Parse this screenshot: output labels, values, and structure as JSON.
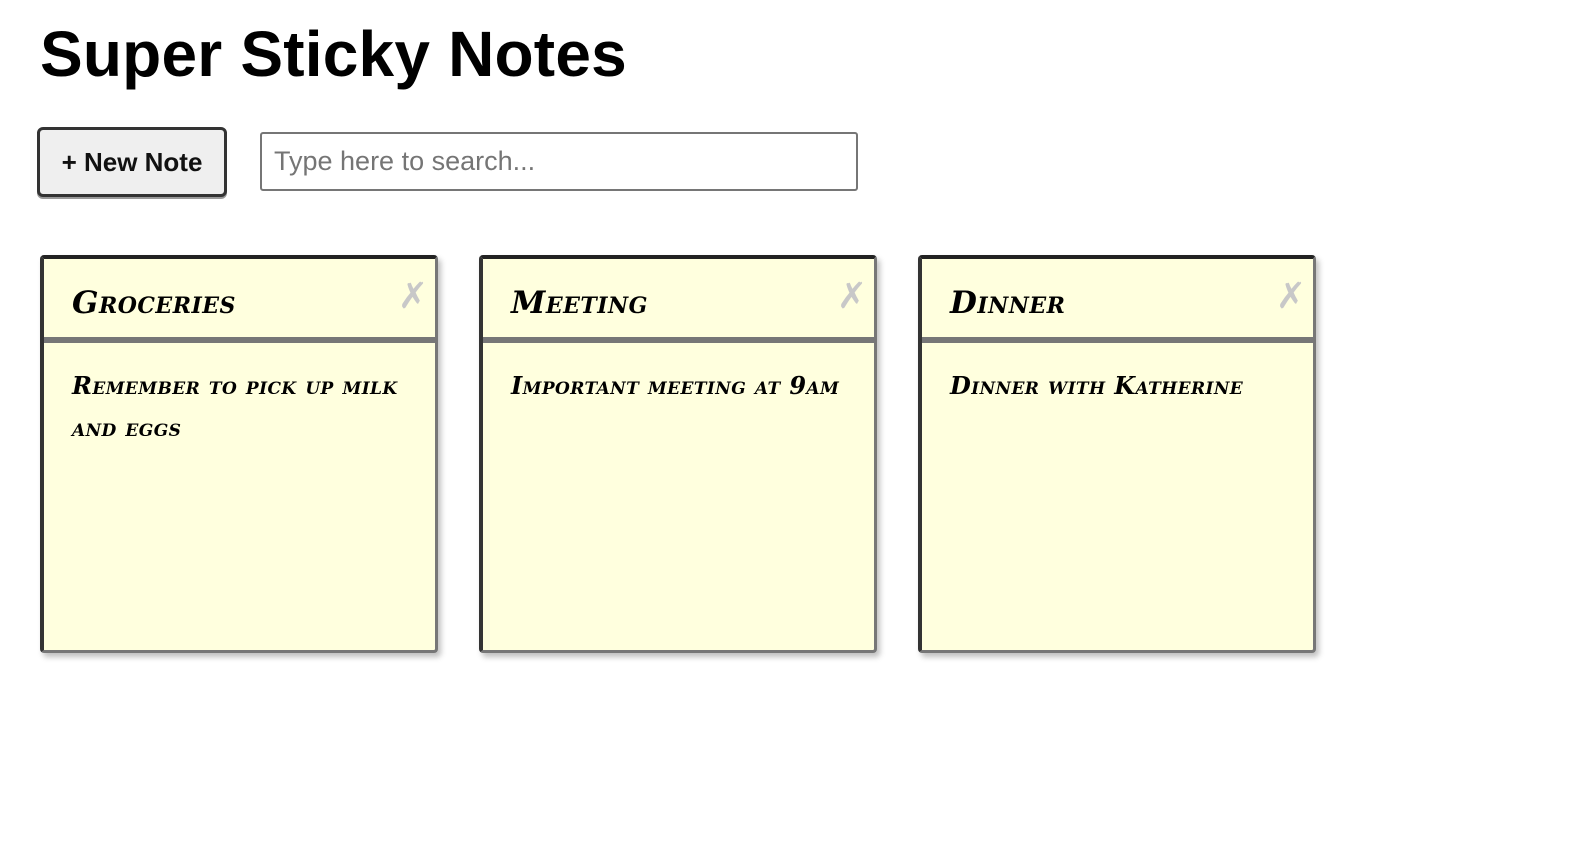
{
  "app": {
    "title": "Super Sticky Notes"
  },
  "toolbar": {
    "new_note_label": "+ New Note",
    "search": {
      "placeholder": "Type here to search...",
      "value": ""
    }
  },
  "notes": [
    {
      "title": "Groceries",
      "body": "Remember to pick up milk and eggs",
      "delete_glyph": "✗",
      "delete_icon": "close-icon"
    },
    {
      "title": "Meeting",
      "body": "Important meeting at 9am",
      "delete_glyph": "✗",
      "delete_icon": "close-icon"
    },
    {
      "title": "Dinner",
      "body": "Dinner with Katherine",
      "delete_glyph": "✗",
      "delete_icon": "close-icon"
    }
  ],
  "colors": {
    "note_background": "#ffffde",
    "delete_icon": "#c8c8c8",
    "button_background": "#efefef"
  }
}
